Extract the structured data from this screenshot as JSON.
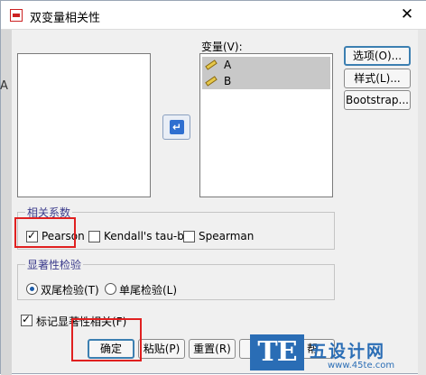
{
  "dialog": {
    "title": "双变量相关性",
    "close_glyph": "✕"
  },
  "left_edge_glyph": "A",
  "variables": {
    "label": "变量(V):",
    "items": [
      {
        "label": "A",
        "icon": "ruler-icon"
      },
      {
        "label": "B",
        "icon": "ruler-icon"
      }
    ]
  },
  "move_button": {
    "icon": "move-arrow-icon",
    "glyph": "↵"
  },
  "side_buttons": {
    "options": "选项(O)...",
    "style": "样式(L)...",
    "bootstrap": "Bootstrap..."
  },
  "coefficients": {
    "legend": "相关系数",
    "pearson": {
      "label": "Pearson",
      "checked": true
    },
    "kendall": {
      "label": "Kendall's tau-b",
      "checked": false
    },
    "spearman": {
      "label": "Spearman",
      "checked": false
    }
  },
  "significance": {
    "legend": "显著性检验",
    "two_tailed": {
      "label": "双尾检验(T)",
      "selected": true
    },
    "one_tailed": {
      "label": "单尾检验(L)",
      "selected": false
    }
  },
  "flag_significant": {
    "label": "标记显著性相关(F)",
    "checked": true
  },
  "bottom_buttons": {
    "ok": "确定",
    "paste": "粘贴(P)",
    "reset": "重置(R)",
    "help": "帮"
  },
  "watermark": {
    "logo": "TE",
    "text": "五设计网",
    "url": "www.45te.com"
  },
  "colors": {
    "highlight": "#e02020",
    "accent": "#2a6db5",
    "default_button_border": "#3c7fb1"
  }
}
